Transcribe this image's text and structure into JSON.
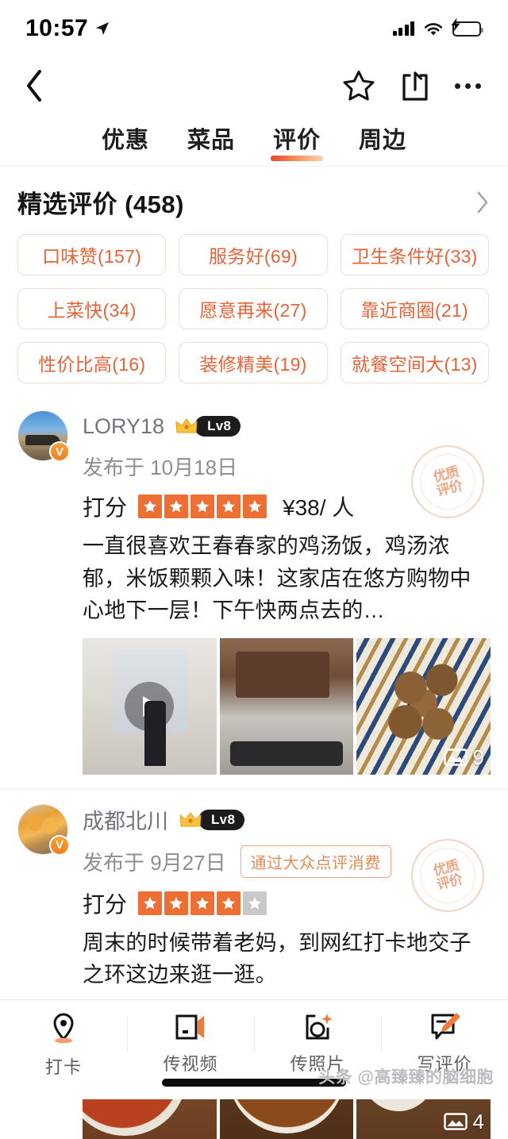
{
  "status_bar": {
    "time": "10:57",
    "location_icon": "location-arrow-icon",
    "signal_icon": "cellular-signal-icon",
    "wifi_icon": "wifi-icon",
    "battery_icon": "battery-charging-icon"
  },
  "nav": {
    "back_icon": "chevron-left-icon",
    "favorite_icon": "star-outline-icon",
    "share_icon": "share-icon",
    "more_icon": "more-dots-icon"
  },
  "tabs": [
    {
      "label": "优惠",
      "active": false
    },
    {
      "label": "菜品",
      "active": false
    },
    {
      "label": "评价",
      "active": true
    },
    {
      "label": "周边",
      "active": false
    }
  ],
  "section": {
    "title": "精选评价 (458)",
    "chevron_icon": "chevron-right-icon"
  },
  "tags": [
    "口味赞(157)",
    "服务好(69)",
    "卫生条件好(33)",
    "上菜快(34)",
    "愿意再来(27)",
    "靠近商圈(21)",
    "性价比高(16)",
    "装修精美(19)",
    "就餐空间大(13)"
  ],
  "reviews": [
    {
      "username": "LORY18",
      "level_badge": "Lv8",
      "crown_icon": "crown-icon",
      "verified_icon": "verified-v-icon",
      "publish_label": "发布于 10月18日",
      "source_badge": "",
      "score_label": "打分",
      "rating": 5,
      "price": "¥38/ 人",
      "text": "一直很喜欢王春春家的鸡汤饭，鸡汤浓郁，米饭颗颗入味！这家店在悠方购物中心地下一层！下午快两点去的…",
      "stamp_text": "优质评价",
      "photo_count": "9",
      "photo_count_icon": "photo-stack-icon",
      "has_video": true,
      "play_icon": "play-icon"
    },
    {
      "username": "成都北川",
      "level_badge": "Lv8",
      "crown_icon": "crown-icon",
      "verified_icon": "verified-v-icon",
      "publish_label": "发布于 9月27日",
      "source_badge": "通过大众点评消费",
      "score_label": "打分",
      "rating": 4,
      "price": "",
      "text": "周末的时候带着老妈，到网红打卡地交子之环这边来逛一逛。",
      "stamp_text": "优质评价",
      "photo_count": "4",
      "photo_count_icon": "photo-stack-icon",
      "has_video": true,
      "play_icon": "play-icon"
    }
  ],
  "bottom_bar": [
    {
      "label": "打卡",
      "icon": "location-pin-icon"
    },
    {
      "label": "传视频",
      "icon": "video-upload-icon"
    },
    {
      "label": "传照片",
      "icon": "photo-upload-icon"
    },
    {
      "label": "写评价",
      "icon": "write-review-icon"
    }
  ],
  "watermark": "头条 @高臻臻的脑细胞",
  "colors": {
    "accent": "#ee6f36",
    "tag_text": "#e4643a",
    "tab_underline": "#e8452c",
    "battery_green": "#34c759"
  }
}
